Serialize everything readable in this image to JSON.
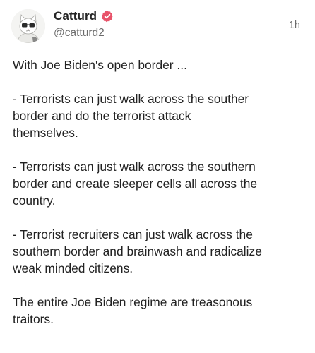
{
  "post": {
    "author": {
      "display_name": "Catturd",
      "handle": "@catturd2",
      "verified_icon": "verified-badge-icon",
      "verified_color": "#e8536a",
      "avatar": "cat-with-glasses-avatar"
    },
    "timestamp": "1h",
    "paragraphs": [
      "With Joe Biden's open border ...",
      "- Terrorists can just walk across the souther\nborder and do the terrorist attack\nthemselves.",
      "- Terrorists can just walk across the southern\nborder and create sleeper cells all across the\ncountry.",
      "- Terrorist recruiters can just walk across the\nsouthern border and brainwash and radicalize\nweak minded citizens.",
      "The entire Joe Biden regime are treasonous\ntraitors."
    ]
  }
}
